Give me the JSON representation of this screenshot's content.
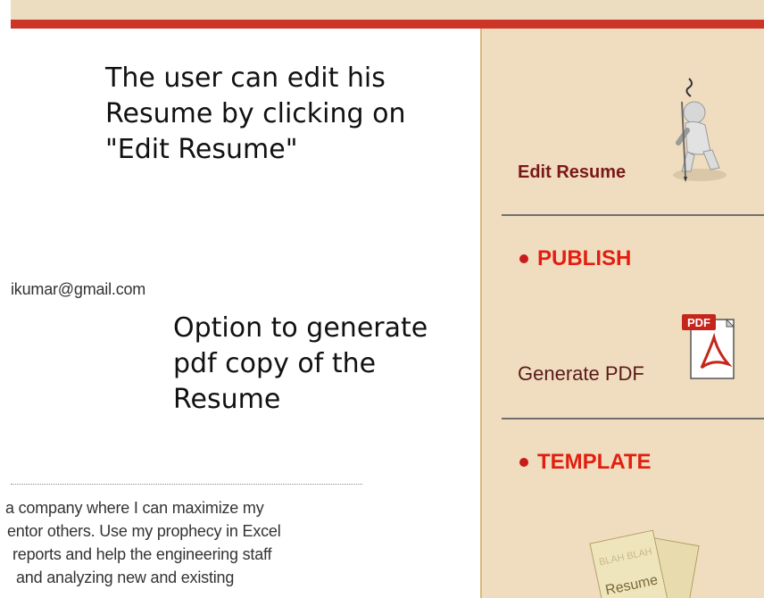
{
  "annotations": {
    "edit_resume_note": "The user can edit his\nResume by clicking on\n\"Edit Resume\"",
    "pdf_note": "Option to generate\npdf copy of the\nResume"
  },
  "main": {
    "email_fragment": "ikumar@gmail.com",
    "objective_lines": [
      "a company where I can maximize my",
      "entor others. Use my prophecy in Excel",
      "reports and help the engineering staff",
      "and analyzing new and existing"
    ]
  },
  "sidebar": {
    "edit_resume_label": "Edit Resume",
    "publish_heading": "PUBLISH",
    "generate_pdf_label": "Generate PDF",
    "pdf_icon_text": "PDF",
    "template_heading": "TEMPLATE",
    "template_icon_text": "Resume",
    "template_icon_scribble": "BLAH BLAH"
  },
  "colors": {
    "top_band": "#ecdcc0",
    "red_bar": "#cc3527",
    "sidebar_bg": "#f0ddbf",
    "heading_red": "#e31e10",
    "link_dark_red": "#7a1818"
  },
  "icons": {
    "edit": "figure-with-pencil-icon",
    "pdf": "pdf-document-icon",
    "template": "resume-papers-icon"
  }
}
